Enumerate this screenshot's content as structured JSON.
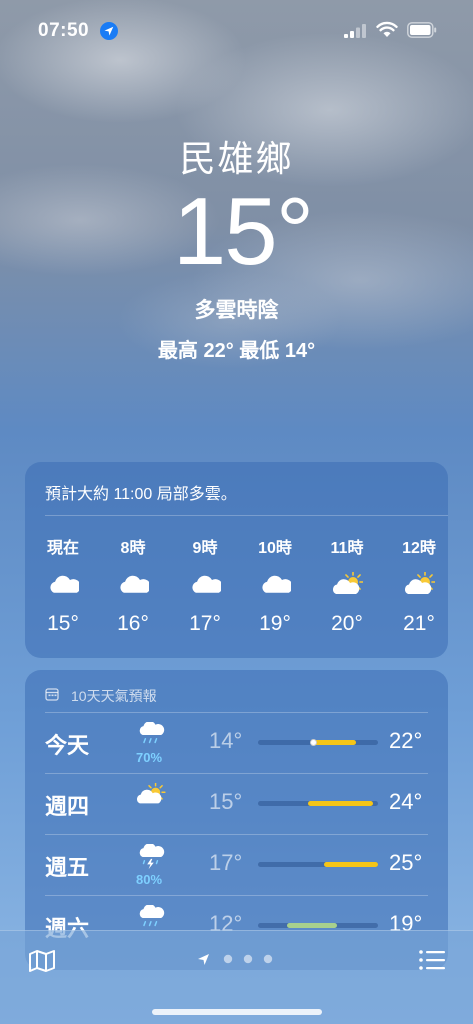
{
  "status_bar": {
    "time": "07:50"
  },
  "hero": {
    "city": "民雄鄉",
    "temperature": "15°",
    "condition": "多雲時陰",
    "high_low": "最高 22°  最低 14°"
  },
  "hourly": {
    "summary": "預計大約 11:00 局部多雲。",
    "items": [
      {
        "label": "現在",
        "icon": "cloud-icon",
        "temp": "15°"
      },
      {
        "label": "8時",
        "icon": "cloud-icon",
        "temp": "16°"
      },
      {
        "label": "9時",
        "icon": "cloud-icon",
        "temp": "17°"
      },
      {
        "label": "10時",
        "icon": "cloud-icon",
        "temp": "19°"
      },
      {
        "label": "11時",
        "icon": "partly-cloudy-icon",
        "temp": "20°"
      },
      {
        "label": "12時",
        "icon": "partly-cloudy-icon",
        "temp": "21°"
      }
    ]
  },
  "daily": {
    "header": "10天天氣預報",
    "days": [
      {
        "name": "今天",
        "icon": "rain-cloud-icon",
        "precip": "70%",
        "low": "14°",
        "high": "22°",
        "range_start": 0.45,
        "range_end": 0.82,
        "current": 0.46,
        "color": "#f5c518"
      },
      {
        "name": "週四",
        "icon": "partly-cloudy-icon",
        "precip": "",
        "low": "15°",
        "high": "24°",
        "range_start": 0.42,
        "range_end": 0.96,
        "color": "#f5c518"
      },
      {
        "name": "週五",
        "icon": "thunderstorm-icon",
        "precip": "80%",
        "low": "17°",
        "high": "25°",
        "range_start": 0.55,
        "range_end": 1.0,
        "color": "#f5c518"
      },
      {
        "name": "週六",
        "icon": "rain-cloud-icon",
        "precip": "",
        "low": "12°",
        "high": "19°",
        "range_start": 0.24,
        "range_end": 0.66,
        "color": "#a8d08d"
      }
    ]
  },
  "colors": {
    "precip": "#7ed0ff",
    "bar_warm": "#f5c518",
    "bar_cool": "#a8d08d"
  }
}
